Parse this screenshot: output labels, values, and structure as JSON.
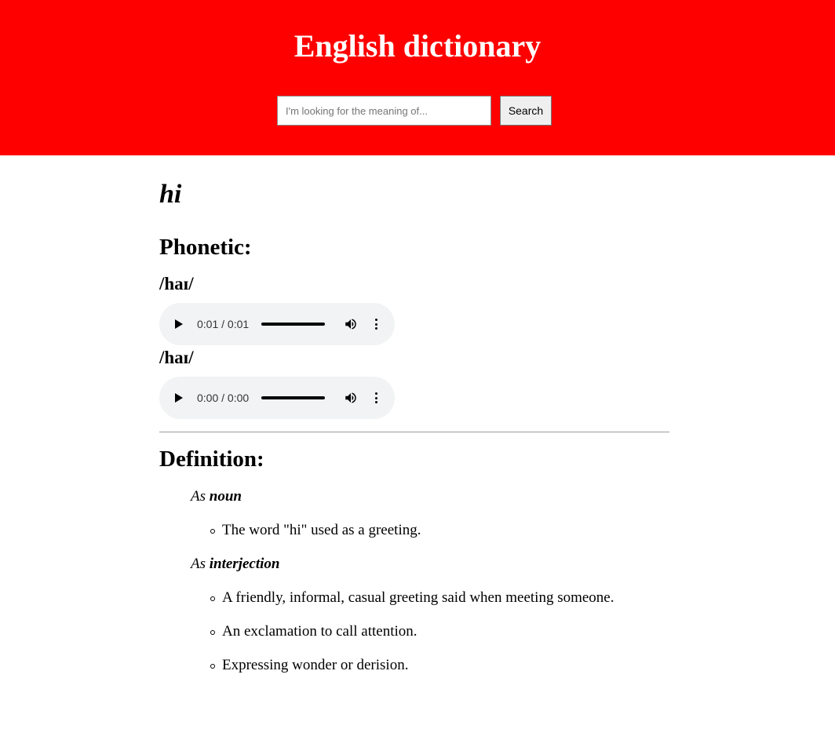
{
  "header": {
    "title": "English dictionary",
    "bg_color": "#ff0000",
    "search": {
      "placeholder": "I'm looking for the meaning of...",
      "value": "",
      "button_label": "Search"
    }
  },
  "entry": {
    "word": "hi",
    "phonetic_heading": "Phonetic:",
    "phonetics": [
      {
        "text": "/haɪ/",
        "time": "0:01 / 0:01"
      },
      {
        "text": "/haɪ/",
        "time": "0:00 / 0:00"
      }
    ],
    "definition_heading": "Definition:",
    "pos": [
      {
        "prefix": "As",
        "name": "noun",
        "meanings": [
          "The word \"hi\" used as a greeting."
        ]
      },
      {
        "prefix": "As",
        "name": "interjection",
        "meanings": [
          "A friendly, informal, casual greeting said when meeting someone.",
          "An exclamation to call attention.",
          "Expressing wonder or derision."
        ]
      }
    ]
  }
}
